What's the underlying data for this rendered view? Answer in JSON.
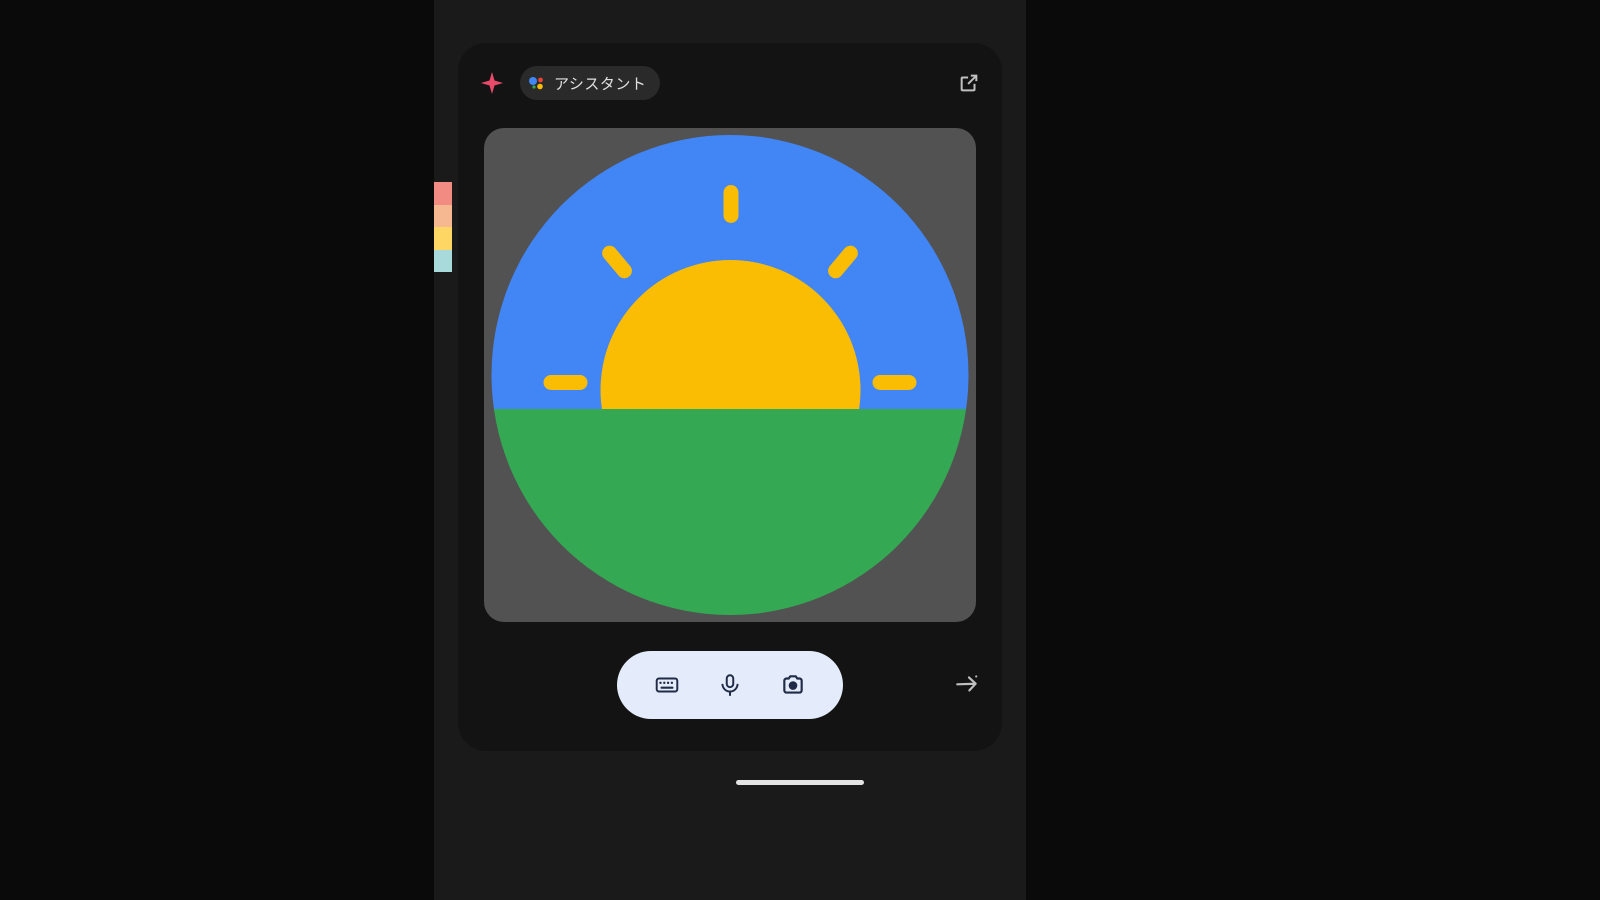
{
  "header": {
    "assistant_label": "アシスタント"
  },
  "icons": {
    "sparkle": "sparkle-icon",
    "assistant": "assistant-icon",
    "popout": "popout-icon",
    "keyboard": "keyboard-icon",
    "mic": "mic-icon",
    "camera": "camera-icon",
    "send": "send-icon"
  },
  "image": {
    "description": "good-morning-routine-illustration",
    "colors": {
      "sky": "#4285f4",
      "ground": "#34a853",
      "sun": "#fbbc04"
    }
  }
}
